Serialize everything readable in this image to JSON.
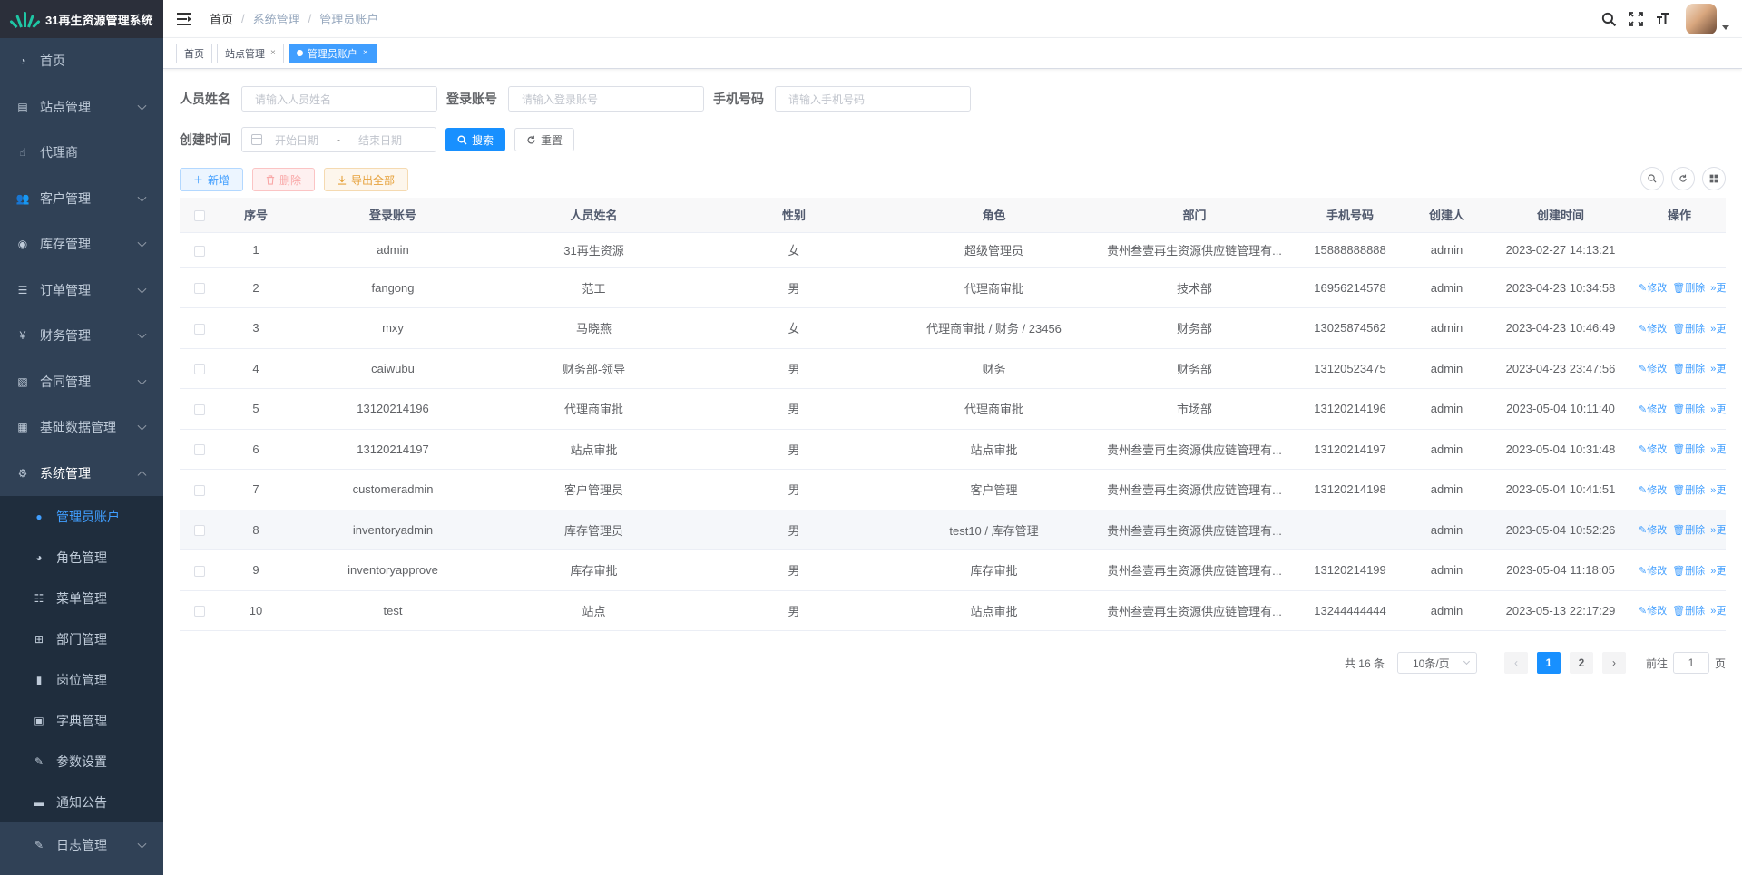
{
  "app": {
    "title": "31再生资源管理系统"
  },
  "sidebar": {
    "items": [
      {
        "label": "首页",
        "icon": "dashboard-icon",
        "expandable": false
      },
      {
        "label": "站点管理",
        "icon": "building-icon",
        "expandable": true
      },
      {
        "label": "代理商",
        "icon": "handshake-icon",
        "expandable": false
      },
      {
        "label": "客户管理",
        "icon": "users-icon",
        "expandable": true
      },
      {
        "label": "库存管理",
        "icon": "globe-icon",
        "expandable": true
      },
      {
        "label": "订单管理",
        "icon": "list-icon",
        "expandable": true
      },
      {
        "label": "财务管理",
        "icon": "yen-icon",
        "expandable": true
      },
      {
        "label": "合同管理",
        "icon": "contract-icon",
        "expandable": true
      },
      {
        "label": "基础数据管理",
        "icon": "database-icon",
        "expandable": true
      },
      {
        "label": "系统管理",
        "icon": "gear-icon",
        "expandable": true,
        "open": true
      }
    ],
    "subitems": [
      {
        "label": "管理员账户",
        "icon": "user-icon",
        "active": true
      },
      {
        "label": "角色管理",
        "icon": "user-group-icon"
      },
      {
        "label": "菜单管理",
        "icon": "tree-list-icon"
      },
      {
        "label": "部门管理",
        "icon": "org-chart-icon"
      },
      {
        "label": "岗位管理",
        "icon": "post-icon"
      },
      {
        "label": "字典管理",
        "icon": "dictionary-icon"
      },
      {
        "label": "参数设置",
        "icon": "edit-icon"
      },
      {
        "label": "通知公告",
        "icon": "message-icon"
      }
    ],
    "last_item": {
      "label": "日志管理",
      "icon": "log-icon"
    }
  },
  "navbar": {
    "breadcrumb": [
      "首页",
      "系统管理",
      "管理员账户"
    ]
  },
  "tags": [
    {
      "label": "首页",
      "closable": false,
      "active": false
    },
    {
      "label": "站点管理",
      "closable": true,
      "active": false
    },
    {
      "label": "管理员账户",
      "closable": true,
      "active": true
    }
  ],
  "search": {
    "name_label": "人员姓名",
    "name_placeholder": "请输入人员姓名",
    "account_label": "登录账号",
    "account_placeholder": "请输入登录账号",
    "phone_label": "手机号码",
    "phone_placeholder": "请输入手机号码",
    "created_label": "创建时间",
    "start_placeholder": "开始日期",
    "range_sep": "-",
    "end_placeholder": "结束日期",
    "search_btn": "搜索",
    "reset_btn": "重置"
  },
  "toolbar": {
    "add_btn": "新增",
    "delete_btn": "删除",
    "export_btn": "导出全部"
  },
  "table": {
    "headers": [
      "序号",
      "登录账号",
      "人员姓名",
      "性别",
      "角色",
      "部门",
      "手机号码",
      "创建人",
      "创建时间",
      "操作"
    ],
    "op_labels": {
      "edit": "修改",
      "delete": "删除",
      "more": "更多"
    },
    "rows": [
      {
        "no": "1",
        "account": "admin",
        "name": "31再生资源",
        "gender": "女",
        "role": "超级管理员",
        "dept": "贵州叁壹再生资源供应链管理有...",
        "phone": "15888888888",
        "creator": "admin",
        "created": "2023-02-27 14:13:21",
        "ops": false
      },
      {
        "no": "2",
        "account": "fangong",
        "name": "范工",
        "gender": "男",
        "role": "代理商审批",
        "dept": "技术部",
        "phone": "16956214578",
        "creator": "admin",
        "created": "2023-04-23 10:34:58",
        "ops": true
      },
      {
        "no": "3",
        "account": "mxy",
        "name": "马晓燕",
        "gender": "女",
        "role": "代理商审批 / 财务 / 23456",
        "dept": "财务部",
        "phone": "13025874562",
        "creator": "admin",
        "created": "2023-04-23 10:46:49",
        "ops": true
      },
      {
        "no": "4",
        "account": "caiwubu",
        "name": "财务部-领导",
        "gender": "男",
        "role": "财务",
        "dept": "财务部",
        "phone": "13120523475",
        "creator": "admin",
        "created": "2023-04-23 23:47:56",
        "ops": true
      },
      {
        "no": "5",
        "account": "13120214196",
        "name": "代理商审批",
        "gender": "男",
        "role": "代理商审批",
        "dept": "市场部",
        "phone": "13120214196",
        "creator": "admin",
        "created": "2023-05-04 10:11:40",
        "ops": true
      },
      {
        "no": "6",
        "account": "13120214197",
        "name": "站点审批",
        "gender": "男",
        "role": "站点审批",
        "dept": "贵州叁壹再生资源供应链管理有...",
        "phone": "13120214197",
        "creator": "admin",
        "created": "2023-05-04 10:31:48",
        "ops": true
      },
      {
        "no": "7",
        "account": "customeradmin",
        "name": "客户管理员",
        "gender": "男",
        "role": "客户管理",
        "dept": "贵州叁壹再生资源供应链管理有...",
        "phone": "13120214198",
        "creator": "admin",
        "created": "2023-05-04 10:41:51",
        "ops": true
      },
      {
        "no": "8",
        "account": "inventoryadmin",
        "name": "库存管理员",
        "gender": "男",
        "role": "test10 / 库存管理",
        "dept": "贵州叁壹再生资源供应链管理有...",
        "phone": "",
        "creator": "admin",
        "created": "2023-05-04 10:52:26",
        "ops": true
      },
      {
        "no": "9",
        "account": "inventoryapprove",
        "name": "库存审批",
        "gender": "男",
        "role": "库存审批",
        "dept": "贵州叁壹再生资源供应链管理有...",
        "phone": "13120214199",
        "creator": "admin",
        "created": "2023-05-04 11:18:05",
        "ops": true
      },
      {
        "no": "10",
        "account": "test",
        "name": "站点",
        "gender": "男",
        "role": "站点审批",
        "dept": "贵州叁壹再生资源供应链管理有...",
        "phone": "13244444444",
        "creator": "admin",
        "created": "2023-05-13 22:17:29",
        "ops": true
      }
    ]
  },
  "pagination": {
    "total_text": "共 16 条",
    "page_size": "10条/页",
    "pages": [
      "1",
      "2"
    ],
    "current": "1",
    "jump_label": "前往",
    "jump_value": "1",
    "page_unit": "页"
  },
  "colors": {
    "sidebar_bg": "#304156",
    "accent": "#409eff",
    "primary_btn": "#1890ff"
  }
}
